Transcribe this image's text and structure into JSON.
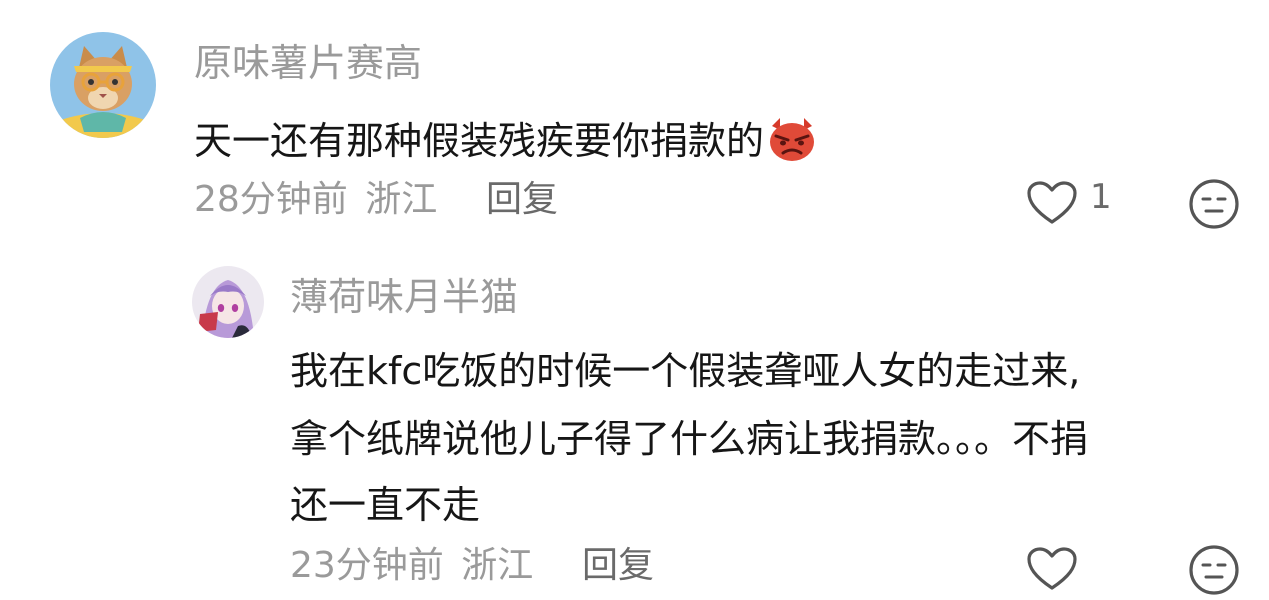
{
  "comments": [
    {
      "username": "原味薯片赛高",
      "content": "天一还有那种假装残疾要你捐款的",
      "emoji_icon": "angry-devil-face-emoji",
      "time": "28分钟前",
      "location": "浙江",
      "reply_label": "回复",
      "like_count": "1",
      "like_icon": "heart-outline-icon",
      "dislike_icon": "neutral-face-icon"
    },
    {
      "username": "薄荷味月半猫",
      "content_lines": [
        "我在kfc吃饭的时候一个假装聋哑人女的走过来,",
        "拿个纸牌说他儿子得了什么病让我捐款。。。不捐",
        "还一直不走"
      ],
      "time": "23分钟前",
      "location": "浙江",
      "reply_label": "回复",
      "like_icon": "heart-outline-icon",
      "dislike_icon": "neutral-face-icon"
    }
  ],
  "colors": {
    "text_primary": "#161616",
    "text_secondary": "#9a9a9a",
    "reply_text": "#6a6a6a",
    "icon_stroke": "#555555"
  }
}
